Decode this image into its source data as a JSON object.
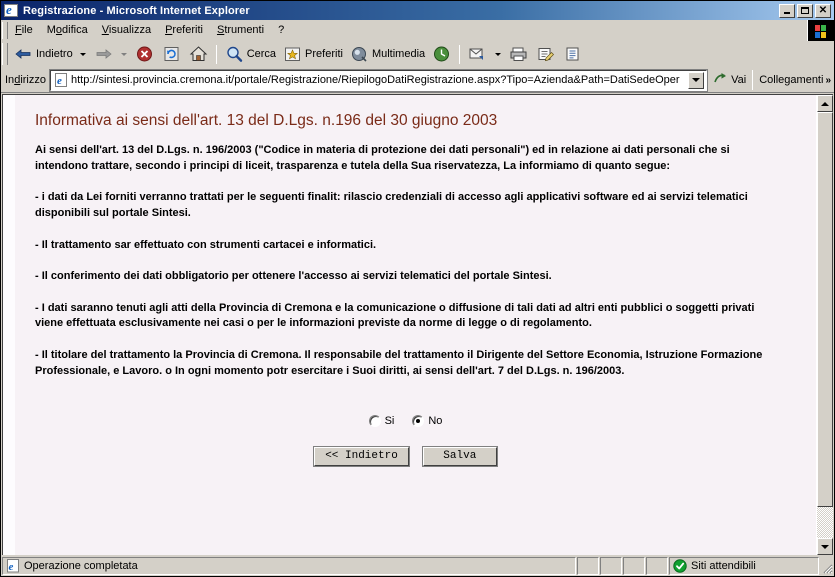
{
  "window": {
    "title": "Registrazione - Microsoft Internet Explorer",
    "icon": "ie-document-icon",
    "minimize_label": "_",
    "maximize_label": "□",
    "close_label": "✕"
  },
  "menubar": {
    "items": [
      {
        "label": "File",
        "accel": "F"
      },
      {
        "label": "Modifica",
        "accel": "o"
      },
      {
        "label": "Visualizza",
        "accel": "V"
      },
      {
        "label": "Preferiti",
        "accel": "P"
      },
      {
        "label": "Strumenti",
        "accel": "S"
      },
      {
        "label": "?",
        "accel": ""
      }
    ]
  },
  "toolbar": {
    "back_label": "Indietro",
    "forward_label": "",
    "stop_label": "",
    "refresh_label": "",
    "home_label": "",
    "search_label": "Cerca",
    "favorites_label": "Preferiti",
    "media_label": "Multimedia",
    "history_label": "",
    "mail_label": "",
    "print_label": "",
    "edit_label": "",
    "discuss_label": "",
    "icons": [
      "back-arrow-icon",
      "forward-arrow-icon",
      "stop-icon",
      "refresh-icon",
      "home-icon",
      "search-icon",
      "favorites-star-icon",
      "media-icon",
      "history-icon",
      "mail-icon",
      "print-icon",
      "edit-icon",
      "discussions-icon"
    ]
  },
  "address": {
    "label": "Indirizzo",
    "url": "http://sintesi.provincia.cremona.it/portale/Registrazione/RiepilogoDatiRegistrazione.aspx?Tipo=Azienda&Path=DatiSedeOper",
    "go_label": "Vai",
    "links_label": "Collegamenti",
    "links_overflow": "»",
    "icon": "page-icon"
  },
  "document": {
    "title": "Informativa ai sensi dell'art. 13 del D.Lgs. n.196 del 30 giugno 2003",
    "title_color": "#7a2b18",
    "paragraphs": [
      "Ai sensi dell'art. 13 del D.Lgs. n. 196/2003 (\"Codice in materia di protezione dei dati personali\") ed in relazione ai dati personali che si intendono trattare, secondo i principi di liceit, trasparenza e tutela della Sua riservatezza, La informiamo di quanto segue:",
      "- i dati da Lei forniti verranno trattati per le seguenti finalit: rilascio credenziali di accesso agli applicativi software ed ai servizi telematici disponibili sul portale Sintesi.",
      "- Il trattamento sar effettuato con strumenti cartacei e informatici.",
      "- Il conferimento dei dati obbligatorio per ottenere l'accesso ai servizi telematici del portale Sintesi.",
      "- I dati saranno tenuti agli atti della Provincia di Cremona e la comunicazione o diffusione di tali dati ad altri enti pubblici o soggetti privati viene effettuata esclusivamente nei casi o per le informazioni previste da norme di legge o di regolamento.",
      "- Il titolare del trattamento la Provincia di Cremona. Il responsabile del trattamento il Dirigente del Settore Economia, Istruzione Formazione Professionale, e Lavoro. o In ogni momento potr esercitare i Suoi diritti, ai sensi dell'art. 7 del D.Lgs. n. 196/2003."
    ],
    "form": {
      "consent_yes_label": "Si",
      "consent_no_label": "No",
      "consent_selected": "No",
      "back_button": "<< Indietro",
      "save_button": "Salva"
    }
  },
  "statusbar": {
    "message": "Operazione completata",
    "zone": "Siti attendibili",
    "zone_icon": "trusted-sites-check-icon",
    "message_icon": "ie-page-icon"
  }
}
